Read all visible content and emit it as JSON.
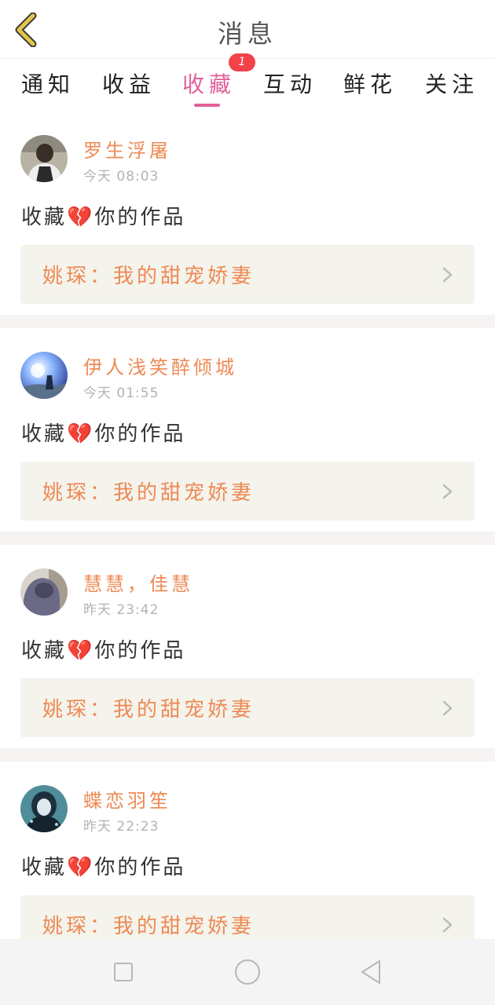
{
  "header": {
    "title": "消息",
    "back_icon": "chevron-left-icon",
    "accent": "#e3c64a"
  },
  "tabs": [
    {
      "label": "通知",
      "active": false
    },
    {
      "label": "收益",
      "active": false
    },
    {
      "label": "收藏",
      "active": true,
      "badge": "1"
    },
    {
      "label": "互动",
      "active": false
    },
    {
      "label": "鲜花",
      "active": false
    },
    {
      "label": "关注",
      "active": false
    }
  ],
  "colors": {
    "active_tab": "#e2609a",
    "name": "#ee8a54",
    "badge": "#f2424a",
    "card_bg": "#f4f3ec"
  },
  "messages": [
    {
      "name": "罗生浮屠",
      "time": "今天 08:03",
      "action": "收藏💔你的作品",
      "work": "姚琛：我的甜宠娇妻"
    },
    {
      "name": "伊人浅笑醉倾城",
      "time": "今天 01:55",
      "action": "收藏💔你的作品",
      "work": "姚琛：我的甜宠娇妻"
    },
    {
      "name": "慧慧，佳慧",
      "time": "昨天 23:42",
      "action": "收藏💔你的作品",
      "work": "姚琛：我的甜宠娇妻"
    },
    {
      "name": "蝶恋羽笙",
      "time": "昨天 22:23",
      "action": "收藏💔你的作品",
      "work": "姚琛：我的甜宠娇妻"
    }
  ],
  "navbar": {
    "icons": [
      "square-icon",
      "circle-icon",
      "triangle-back-icon"
    ]
  }
}
